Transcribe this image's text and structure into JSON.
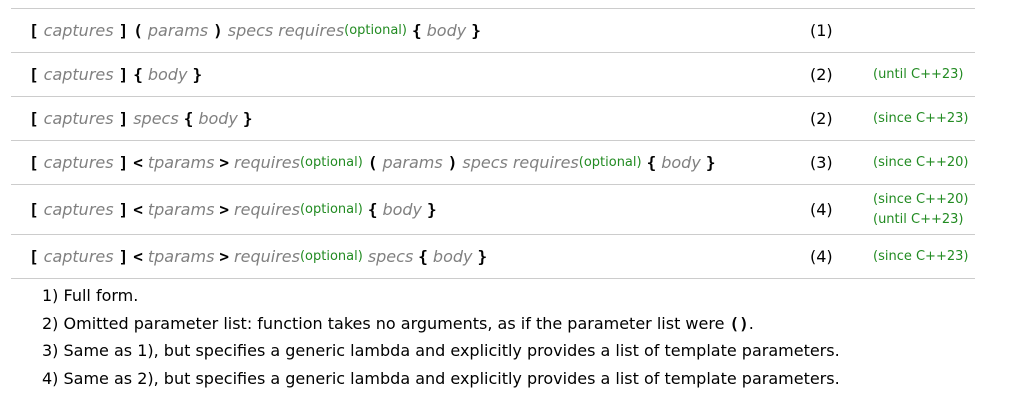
{
  "tokens": {
    "lbracket": "[",
    "rbracket": "]",
    "lparen": "(",
    "rparen": ")",
    "lbrace": "{",
    "rbrace": "}",
    "langle": "<",
    "rangle": ">",
    "captures": "captures",
    "params": "params",
    "tparams": "tparams",
    "specs": "specs",
    "requires": "requires",
    "optional": "(optional)",
    "body": "body"
  },
  "rows": [
    {
      "num": "(1)",
      "ver1": "",
      "ver2": ""
    },
    {
      "num": "(2)",
      "ver1": "(until C++23)",
      "ver2": ""
    },
    {
      "num": "(2)",
      "ver1": "(since C++23)",
      "ver2": ""
    },
    {
      "num": "(3)",
      "ver1": "(since C++20)",
      "ver2": ""
    },
    {
      "num": "(4)",
      "ver1": "(since C++20)",
      "ver2": "(until C++23)"
    },
    {
      "num": "(4)",
      "ver1": "(since C++23)",
      "ver2": ""
    }
  ],
  "notes": [
    {
      "text": "1) Full form."
    },
    {
      "text": "2) Omitted parameter list: function takes no arguments, as if the parameter list were ",
      "code": "()",
      "tail": "."
    },
    {
      "text": "3) Same as 1), but specifies a generic lambda and explicitly provides a list of template parameters."
    },
    {
      "text": "4) Same as 2), but specifies a generic lambda and explicitly provides a list of template parameters."
    }
  ]
}
